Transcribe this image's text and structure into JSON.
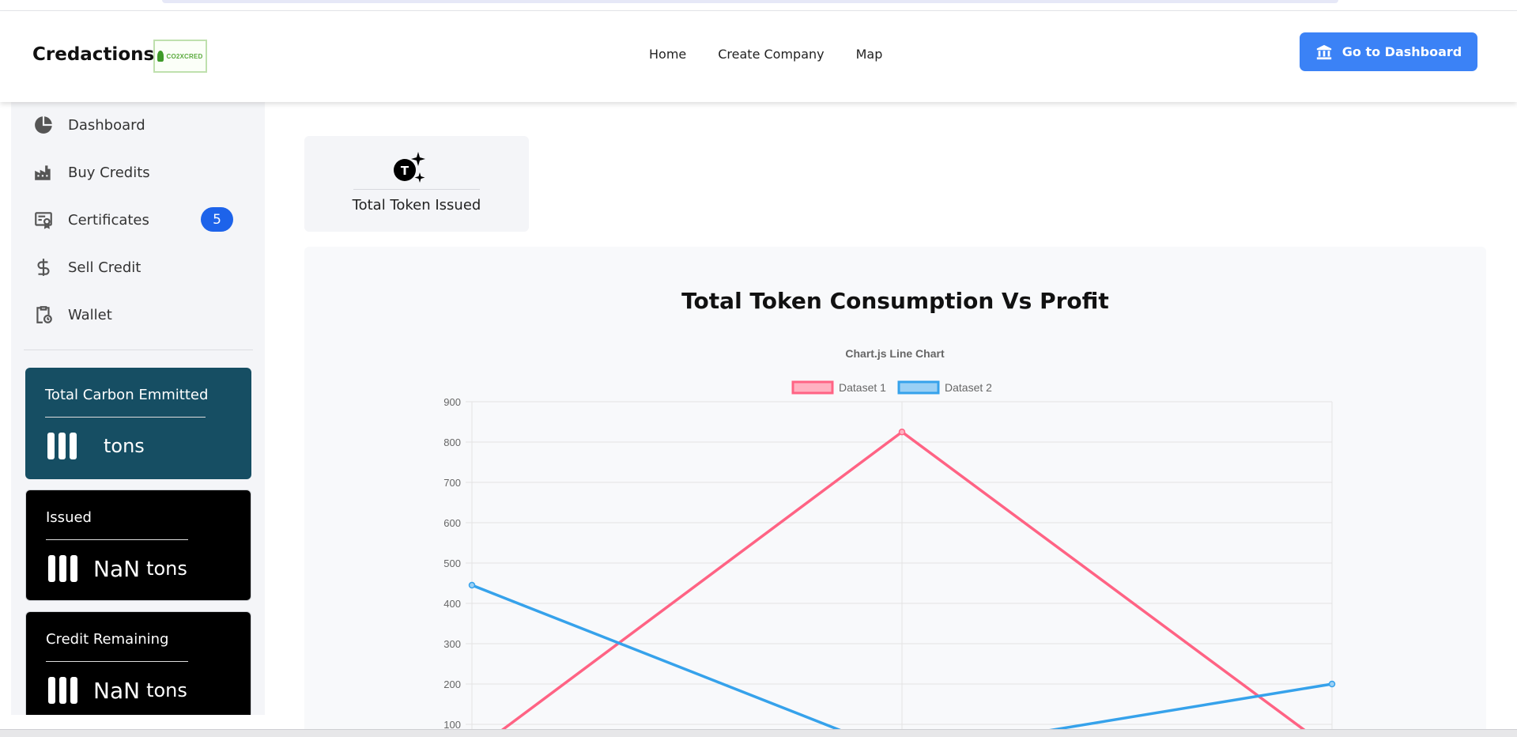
{
  "header": {
    "brand": "Credactions",
    "logo_text": "CO2XCRED",
    "nav": [
      "Home",
      "Create Company",
      "Map"
    ],
    "dashboard_button": "Go to Dashboard"
  },
  "sidebar": {
    "items": [
      {
        "label": "Dashboard",
        "icon": "pie-chart-icon"
      },
      {
        "label": "Buy Credits",
        "icon": "factory-icon"
      },
      {
        "label": "Certificates",
        "icon": "certificate-icon",
        "badge": "5"
      },
      {
        "label": "Sell Credit",
        "icon": "dollar-icon"
      },
      {
        "label": "Wallet",
        "icon": "clipboard-clock-icon"
      }
    ],
    "cards": [
      {
        "title": "Total Carbon Emmitted",
        "value": "",
        "unit": "tons",
        "color": "#164e63"
      },
      {
        "title": "Issued",
        "value": "NaN",
        "unit": "tons",
        "color": "#000000"
      },
      {
        "title": "Credit Remaining",
        "value": "NaN",
        "unit": "tons",
        "color": "#000000"
      }
    ]
  },
  "token_card": {
    "label": "Total Token Issued",
    "icon": "token-sparkle-icon"
  },
  "chart_section": {
    "heading": "Total Token Consumption Vs Profit"
  },
  "chart_data": {
    "type": "line",
    "title": "Chart.js Line Chart",
    "legend_position": "top",
    "grid": true,
    "ylim": [
      0,
      900
    ],
    "yticks": [
      100,
      200,
      300,
      400,
      500,
      600,
      700,
      800,
      900
    ],
    "series": [
      {
        "name": "Dataset 1",
        "color": "#ff6384",
        "fill": "#ffb1c1",
        "values": [
          30,
          825,
          35
        ]
      },
      {
        "name": "Dataset 2",
        "color": "#36a2eb",
        "fill": "#9ad0f5",
        "values": [
          445,
          25,
          200
        ]
      }
    ]
  }
}
